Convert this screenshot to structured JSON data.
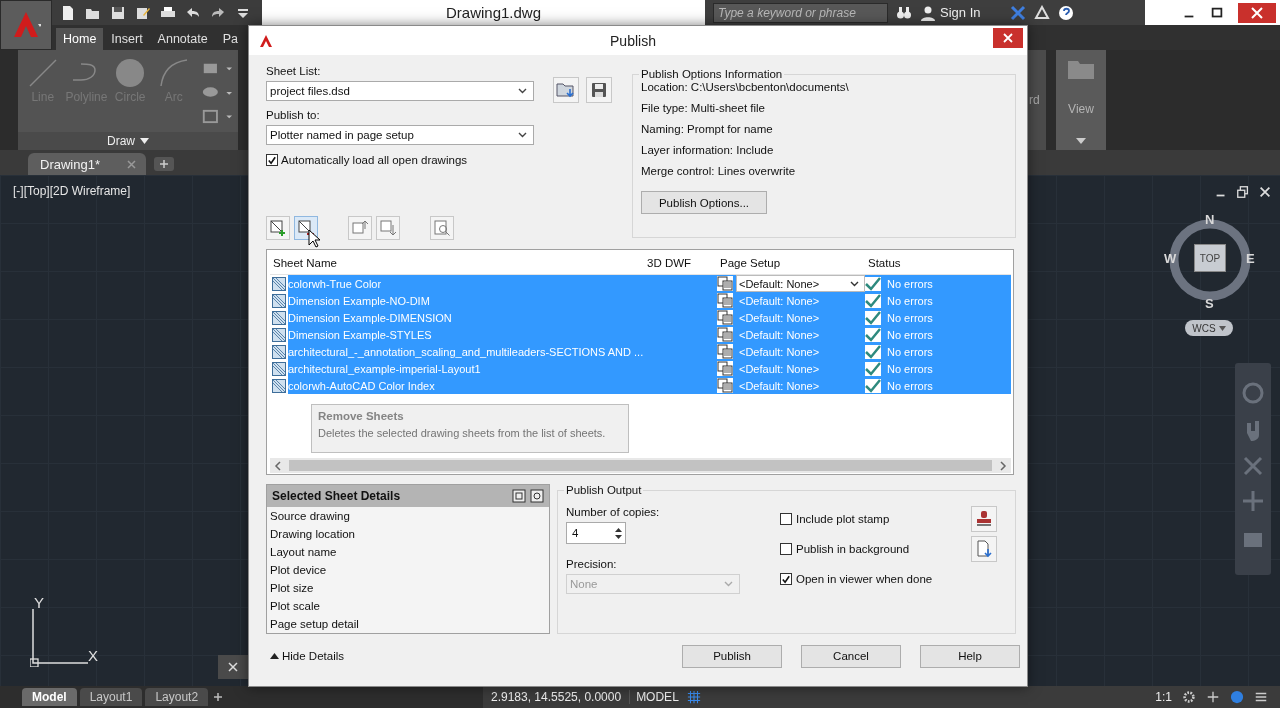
{
  "app": {
    "title": "Drawing1.dwg",
    "search": {
      "placeholder": "Type a keyword or phrase"
    },
    "sign_in": "Sign In",
    "ribbon_tabs": [
      {
        "label": "Home",
        "selected": true
      },
      {
        "label": "Insert",
        "selected": false
      },
      {
        "label": "Annotate",
        "selected": false
      },
      {
        "label": "Pa",
        "selected": false
      }
    ],
    "draw_tools": [
      {
        "label": "Line",
        "kind": "line"
      },
      {
        "label": "Polyline",
        "kind": "polyline"
      },
      {
        "label": "Circle",
        "kind": "circle"
      },
      {
        "label": "Arc",
        "kind": "arc"
      }
    ],
    "draw_panel": "Draw",
    "right_panels": [
      {
        "label": "rd"
      },
      {
        "label": "View"
      }
    ],
    "file_tabs": [
      {
        "label": "Drawing1*",
        "selected": true
      }
    ],
    "viewport_label": "[-][Top][2D Wireframe]",
    "viewcube": {
      "north": "N",
      "west": "W",
      "east": "E",
      "south": "S",
      "face": "TOP",
      "ucs": "WCS"
    },
    "ucs_axes": {
      "y": "Y",
      "x": "X"
    },
    "layout_tabs": [
      {
        "label": "Model",
        "selected": true
      },
      {
        "label": "Layout1",
        "selected": false
      },
      {
        "label": "Layout2",
        "selected": false
      }
    ],
    "status_bar": {
      "coordinates": "2.9183, 14.5525, 0.0000",
      "space": "MODEL",
      "scale": "1:1"
    }
  },
  "dialog": {
    "title": "Publish",
    "sheet_list": {
      "label": "Sheet List:",
      "value": "project files.dsd"
    },
    "publish_to": {
      "label": "Publish to:",
      "value": "Plotter named in page setup"
    },
    "auto_load": {
      "label": "Automatically load all open drawings",
      "checked": true
    },
    "options_info": {
      "title": "Publish Options Information",
      "lines": [
        "Location: C:\\Users\\bcbenton\\documents\\",
        "File type: Multi-sheet file",
        "Naming: Prompt for name",
        "Layer information: Include",
        "Merge control: Lines overwrite"
      ],
      "button": "Publish Options..."
    },
    "sheet_table": {
      "columns": [
        "Sheet Name",
        "3D DWF",
        "Page Setup",
        "Status"
      ],
      "rows": [
        {
          "name": "colorwh-True Color",
          "page_setup": "<Default: None>",
          "page_setup_editing": true,
          "status": "No errors",
          "selected": true
        },
        {
          "name": "Dimension Example-NO-DIM",
          "page_setup": "<Default: None>",
          "page_setup_editing": false,
          "status": "No errors",
          "selected": true
        },
        {
          "name": "Dimension Example-DIMENSION",
          "page_setup": "<Default: None>",
          "page_setup_editing": false,
          "status": "No errors",
          "selected": true
        },
        {
          "name": "Dimension Example-STYLES",
          "page_setup": "<Default: None>",
          "page_setup_editing": false,
          "status": "No errors",
          "selected": true
        },
        {
          "name": "architectural_-_annotation_scaling_and_multileaders-SECTIONS AND ...",
          "page_setup": "<Default: None>",
          "page_setup_editing": false,
          "status": "No errors",
          "selected": true
        },
        {
          "name": "architectural_example-imperial-Layout1",
          "page_setup": "<Default: None>",
          "page_setup_editing": false,
          "status": "No errors",
          "selected": true
        },
        {
          "name": "colorwh-AutoCAD Color Index",
          "page_setup": "<Default: None>",
          "page_setup_editing": false,
          "status": "No errors",
          "selected": true
        }
      ]
    },
    "tooltip": {
      "title": "Remove Sheets",
      "text": "Deletes the selected drawing sheets from the list of sheets."
    },
    "details": {
      "title": "Selected Sheet Details",
      "items": [
        "Source drawing",
        "Drawing location",
        "Layout name",
        "Plot device",
        "Plot size",
        "Plot scale",
        "Page setup detail"
      ]
    },
    "output": {
      "title": "Publish Output",
      "copies_label": "Number of copies:",
      "copies": "4",
      "precision_label": "Precision:",
      "precision": "None",
      "precision_disabled": true,
      "options": [
        {
          "label": "Include plot stamp",
          "checked": false
        },
        {
          "label": "Publish in background",
          "checked": false
        },
        {
          "label": "Open in viewer when done",
          "checked": true
        }
      ]
    },
    "hide_details": "Hide Details",
    "buttons": [
      "Publish",
      "Cancel",
      "Help"
    ]
  }
}
